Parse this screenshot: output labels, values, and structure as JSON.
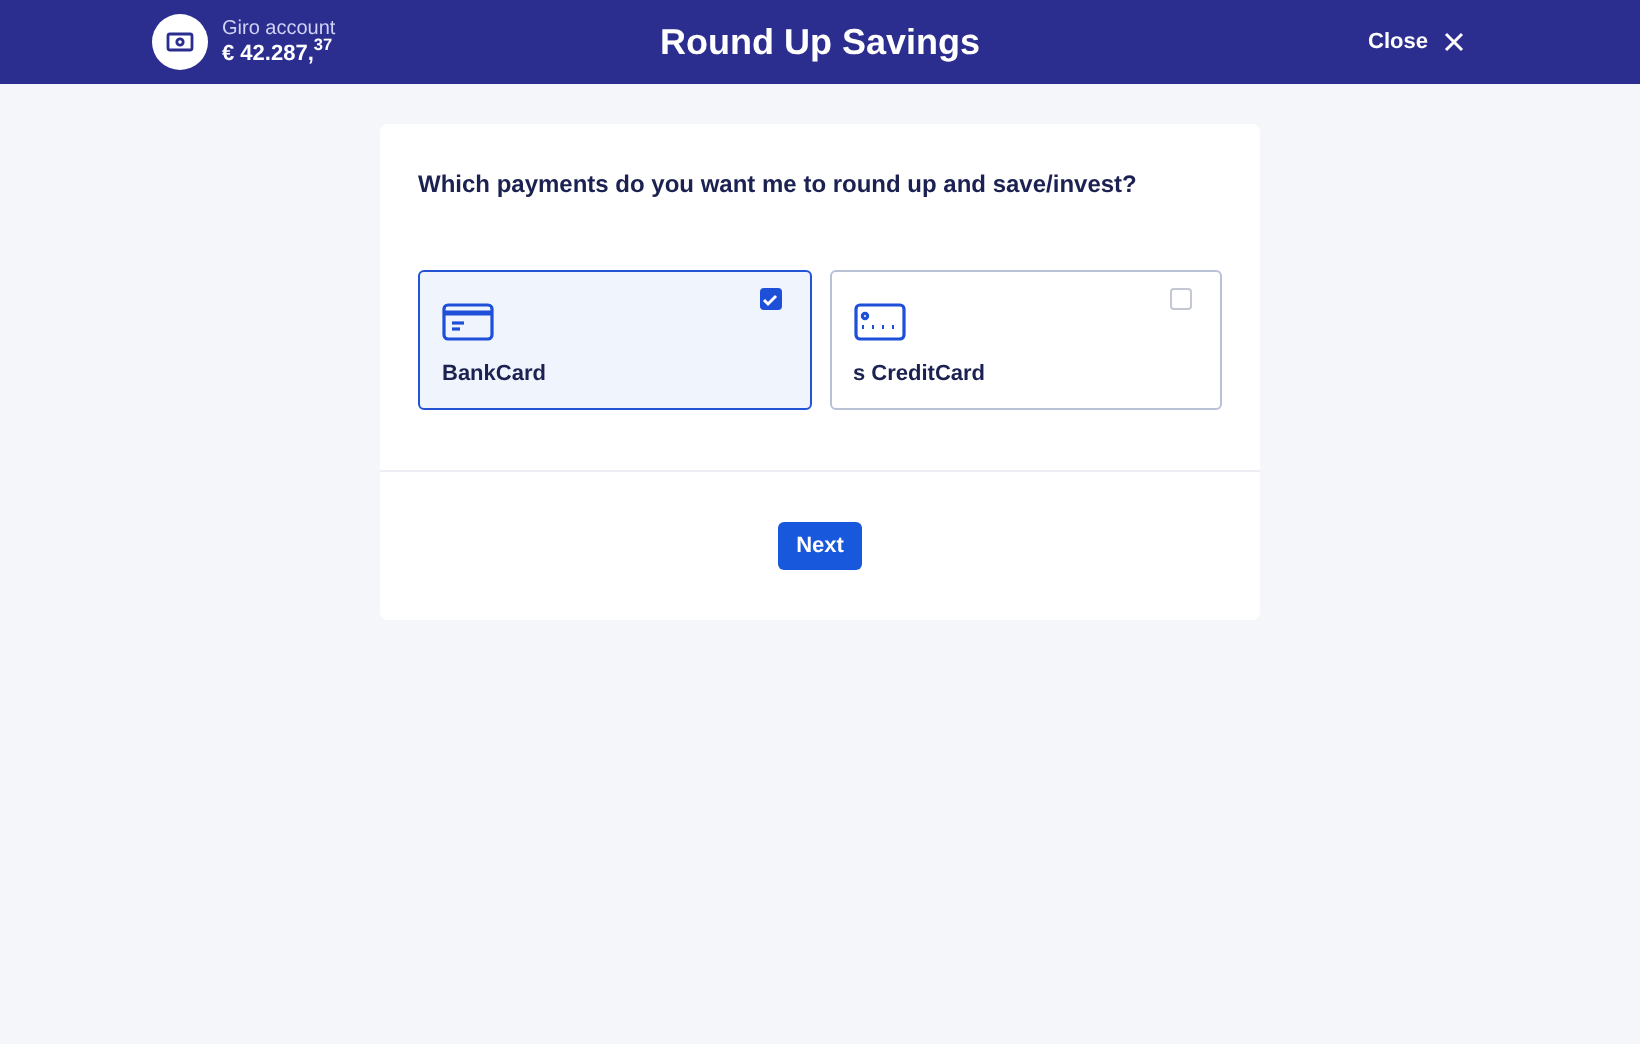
{
  "header": {
    "account_name": "Giro account",
    "balance": "€ 42.287,$^{37}$",
    "title": "Round Up Savings",
    "close": "Close"
  },
  "question": "Which payments do you want me to round up and save/invest?",
  "cards": [
    {
      "kind": "bank",
      "label": "BankCard",
      "selected": true
    },
    {
      "kind": "credit",
      "label": "s CreditCard",
      "selected": false
    }
  ],
  "next_button": "Next"
}
